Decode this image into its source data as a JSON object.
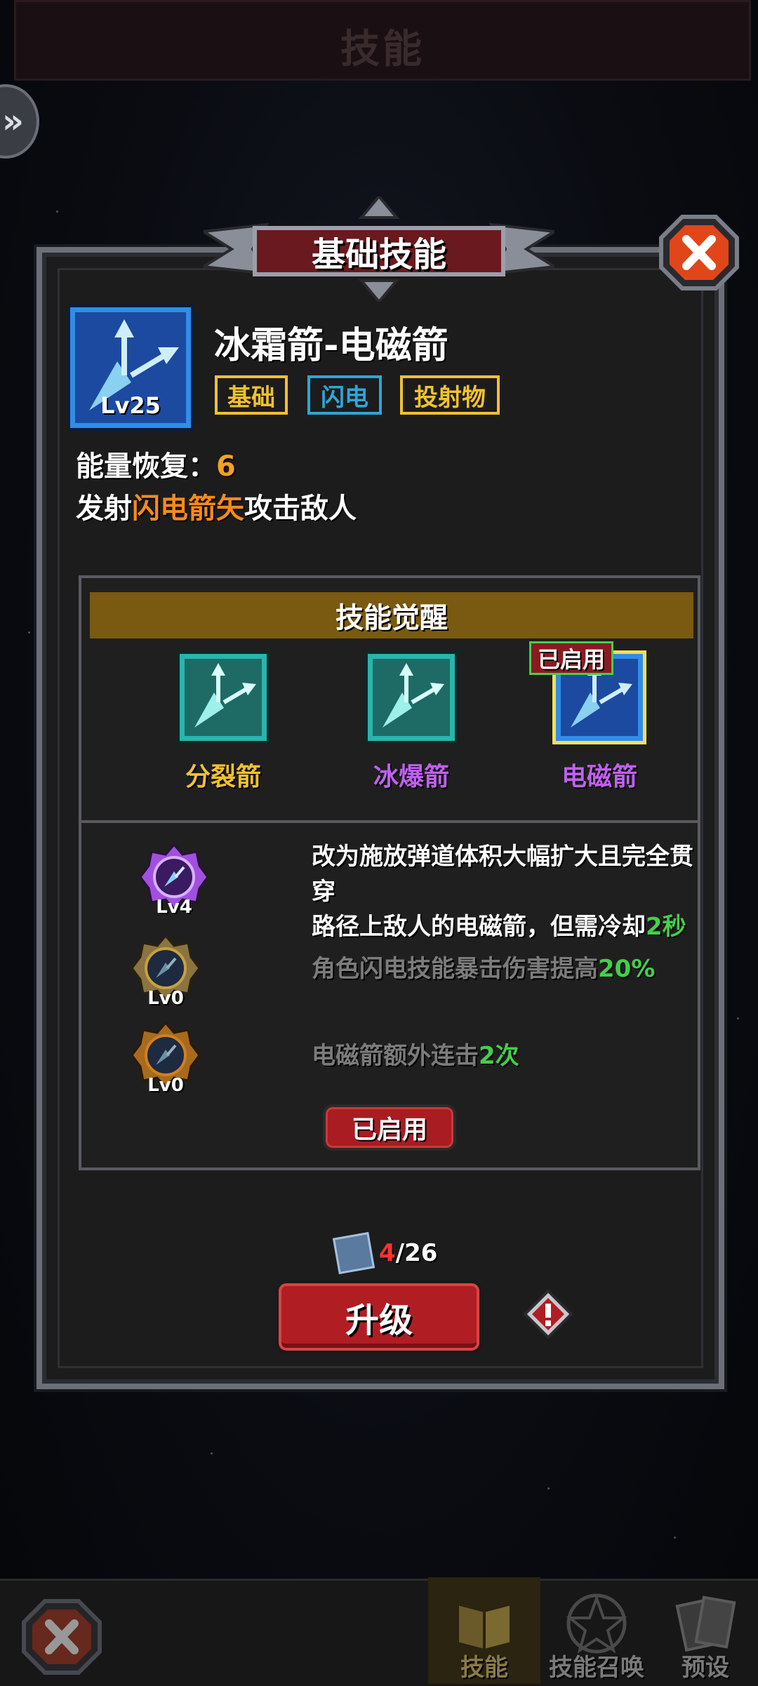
{
  "top_bar": {
    "title": "技能"
  },
  "panel": {
    "title": "基础技能",
    "skill": {
      "name": "冰霜箭-电磁箭",
      "level": "Lv25",
      "tags": [
        {
          "label": "基础",
          "color": "#f2c12e"
        },
        {
          "label": "闪电",
          "color": "#2fa6d8"
        },
        {
          "label": "投射物",
          "color": "#f2c12e"
        }
      ],
      "energy_label": "能量恢复：",
      "energy_value": "6",
      "description_prefix": "发射",
      "description_highlight": "闪电箭矢",
      "description_suffix": "攻击敌人"
    },
    "awakening": {
      "header": "技能觉醒",
      "options": [
        {
          "label": "分裂箭",
          "color": "#f2c12e"
        },
        {
          "label": "冰爆箭",
          "color": "#c060f0"
        },
        {
          "label": "电磁箭",
          "color": "#c060f0"
        }
      ],
      "enabled_tag": "已启用",
      "effects": [
        {
          "level": "Lv4",
          "line1": "改为施放弹道体积大幅扩大且完全贯穿",
          "line2_prefix": "路径上敌人的电磁箭，但需冷却",
          "line2_value": "2秒",
          "text_color": "#ffffff",
          "medal_color": "#a050e0"
        },
        {
          "level": "Lv0",
          "prefix": "角色闪电技能暴击伤害提高",
          "value": "20%",
          "text_color": "#7c7c7c",
          "medal_color": "#c8a040"
        },
        {
          "level": "Lv0",
          "prefix": "电磁箭额外连击",
          "value": "2次",
          "text_color": "#7c7c7c",
          "medal_color": "#d08020"
        }
      ],
      "enabled_button": "已启用"
    },
    "cost": {
      "have": "4",
      "need": "/26"
    },
    "upgrade_button": "升级"
  },
  "bottom_nav": [
    {
      "label": "技能",
      "icon": "book-icon",
      "active": true
    },
    {
      "label": "技能召唤",
      "icon": "pentagram-icon",
      "active": false
    },
    {
      "label": "预设",
      "icon": "cards-icon",
      "active": false
    }
  ]
}
